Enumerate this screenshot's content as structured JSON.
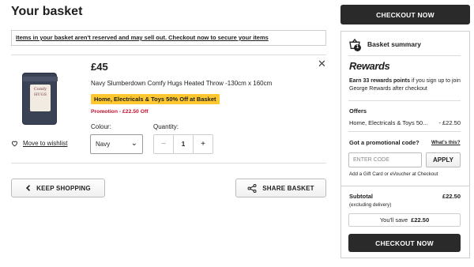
{
  "page": {
    "title": "Your basket"
  },
  "notice": {
    "text": "Items in your basket aren't reserved and may sell out. Checkout now to secure your items"
  },
  "item": {
    "price": "£45",
    "name": "Navy Slumberdown Comfy Hugs Heated Throw -130cm x 160cm",
    "offer_badge": "Home, Electricals & Toys 50% Off at Basket",
    "promotion": "Promotion - £22.50 Off",
    "colour_label": "Colour:",
    "colour_value": "Navy",
    "quantity_label": "Quantity:",
    "quantity_value": "1",
    "wishlist_label": "Move to wishlist",
    "thumb_text": "Comfy HUGS"
  },
  "actions": {
    "keep_shopping": "KEEP SHOPPING",
    "share_basket": "SHARE BASKET"
  },
  "summary": {
    "checkout_top": "CHECKOUT NOW",
    "title": "Basket summary",
    "basket_count": "1",
    "rewards_logo": "Rewards",
    "rewards_bold": "Earn 33 rewards points",
    "rewards_rest": " if you sign up to join George Rewards after checkout",
    "offers_title": "Offers",
    "offer_name": "Home, Electricals & Toys 50...",
    "offer_value": "- £22.50",
    "promo_title": "Got a promotional code?",
    "whats_this": "What's this?",
    "code_placeholder": "ENTER CODE",
    "apply_label": "APPLY",
    "gift_card_text": "Add a Gift Card or eVoucher at Checkout",
    "subtotal_label": "Subtotal",
    "subtotal_value": "£22.50",
    "subtotal_note": "(excluding delivery)",
    "save_label": "You'll save",
    "save_value": "£22.50",
    "checkout_bottom": "CHECKOUT NOW"
  },
  "colors": {
    "dark_button": "#2a2a2a",
    "promo_yellow": "#fdc82f",
    "promo_red": "#c8102e"
  }
}
